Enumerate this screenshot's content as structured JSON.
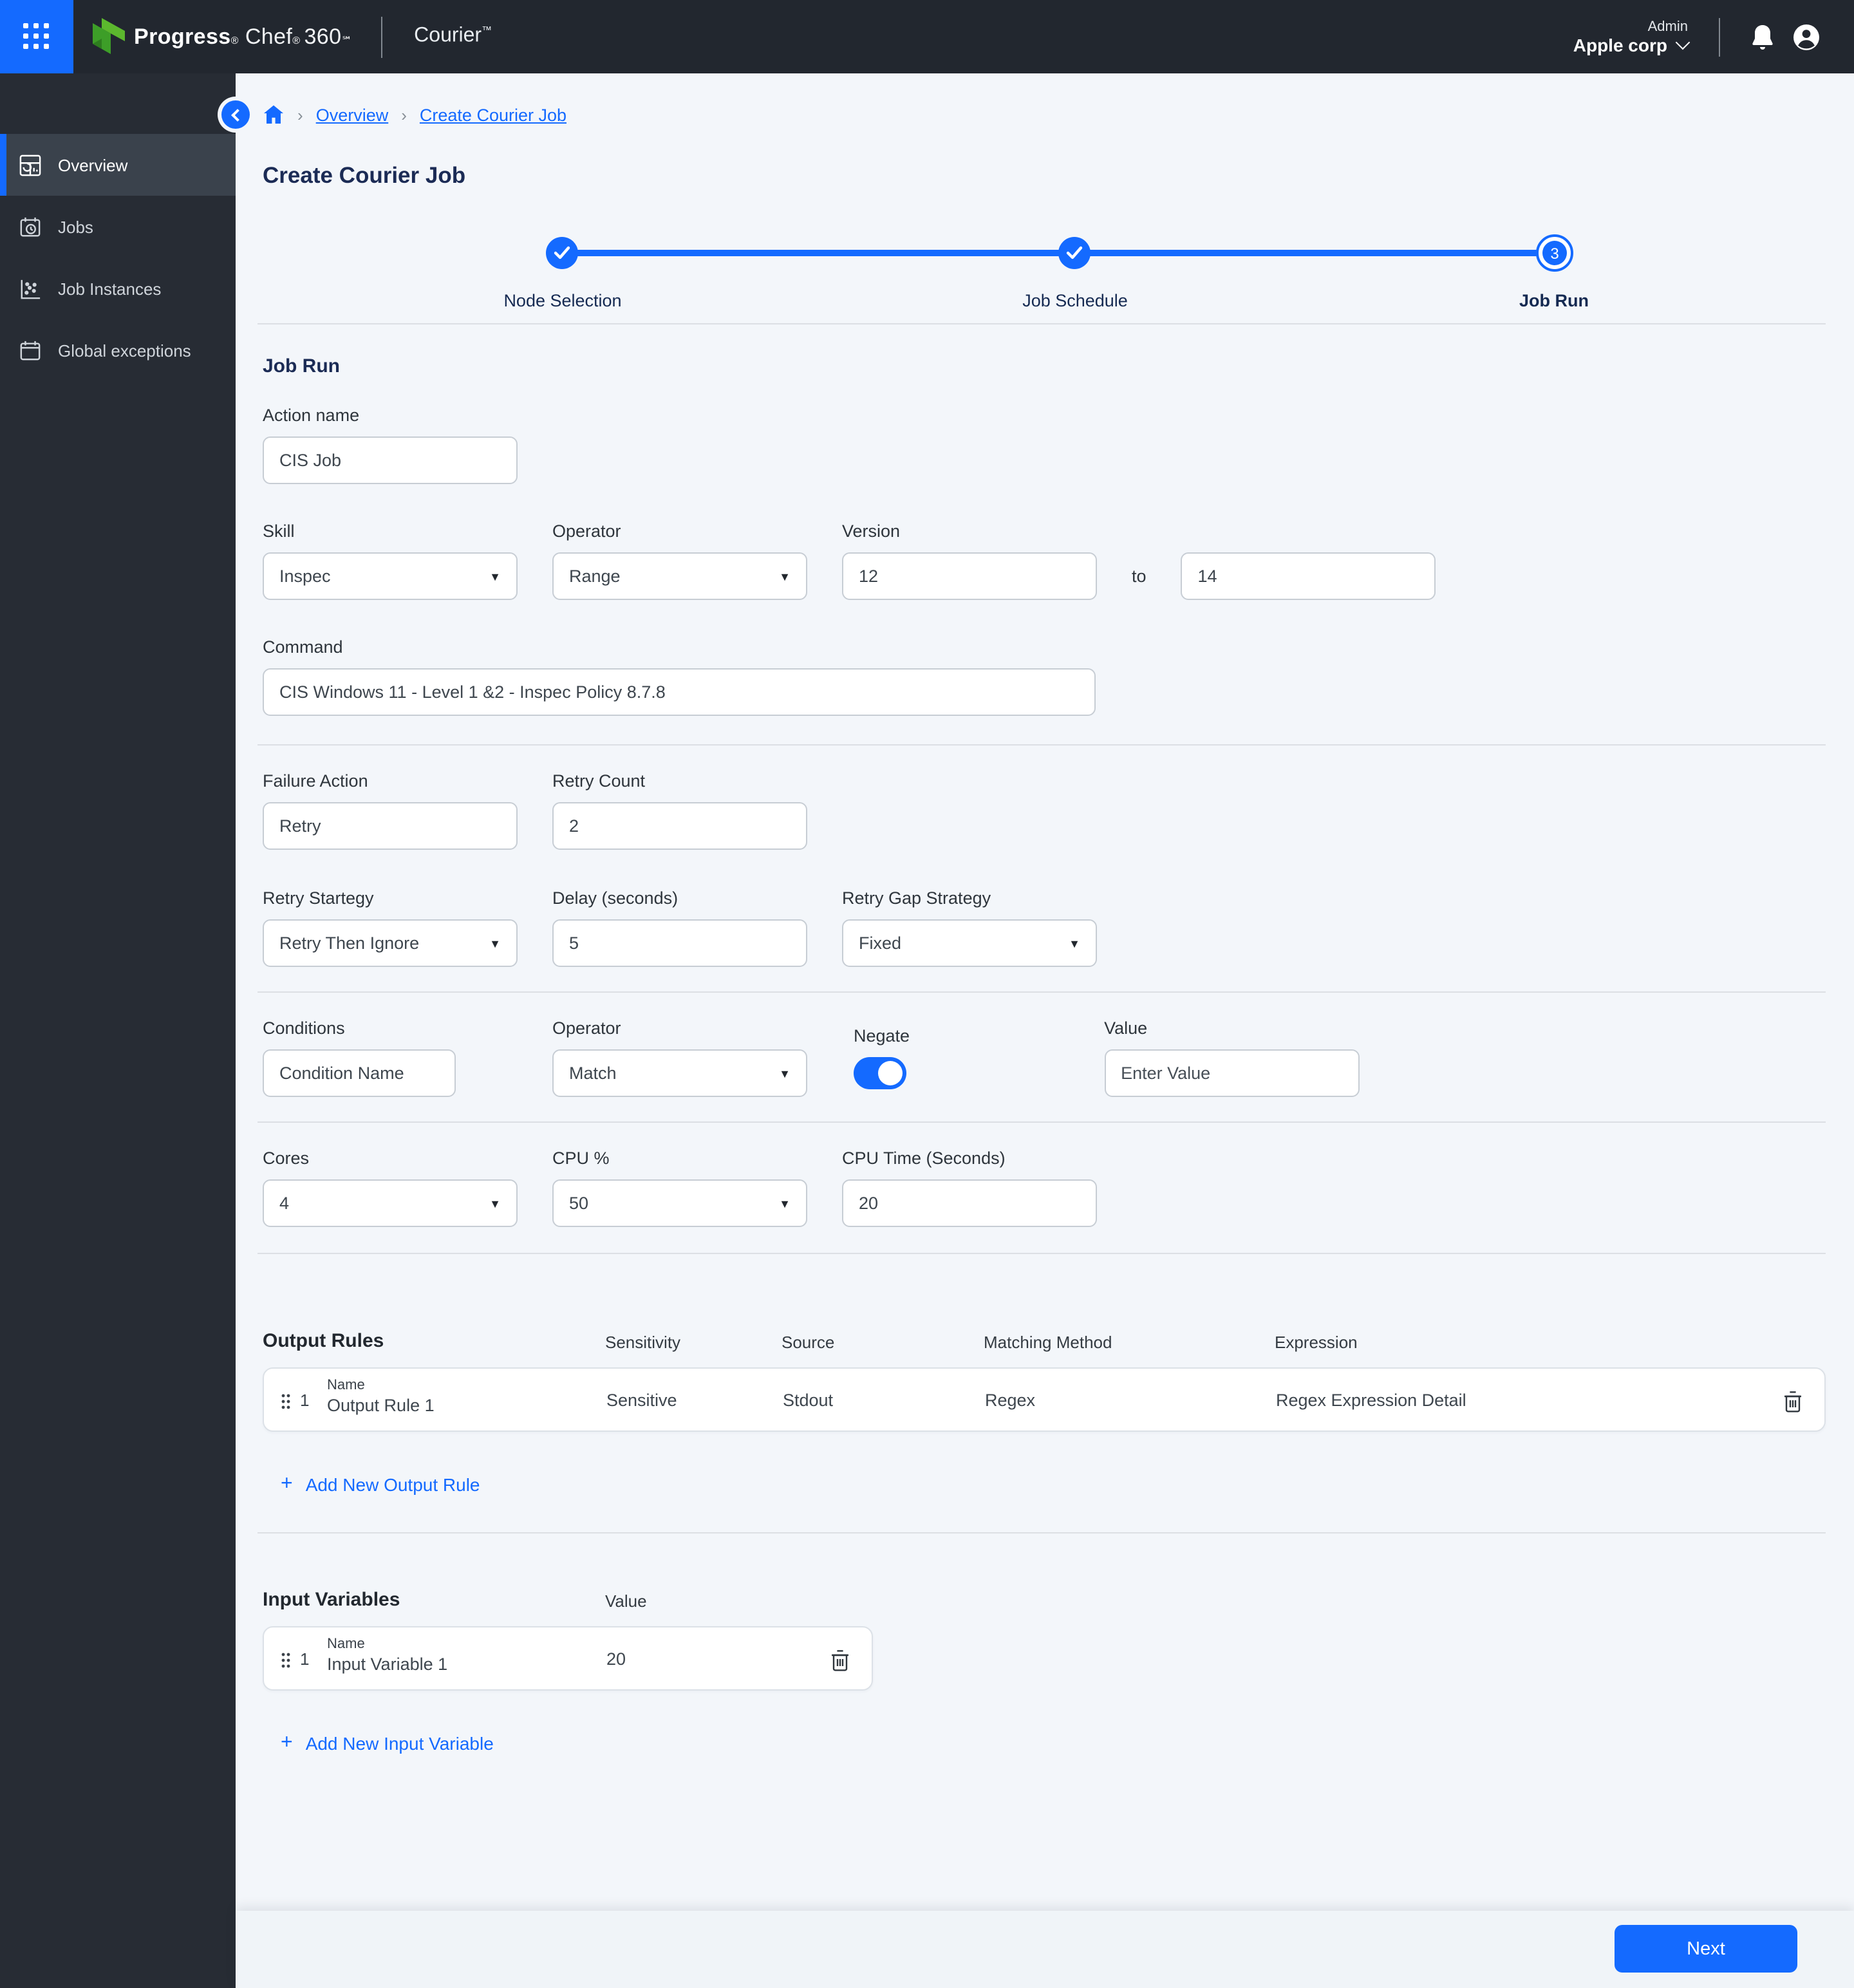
{
  "header": {
    "brand_bold": "Progress",
    "brand_reg": "®",
    "brand_chef": "Chef",
    "brand_chef_reg": "®",
    "brand_num": "360",
    "brand_sm": "℠",
    "product": "Courier",
    "product_tm": "™",
    "role": "Admin",
    "org": "Apple corp"
  },
  "sidebar": {
    "items": [
      {
        "label": "Overview"
      },
      {
        "label": "Jobs"
      },
      {
        "label": "Job Instances"
      },
      {
        "label": "Global exceptions"
      }
    ]
  },
  "breadcrumb": {
    "link1": "Overview",
    "link2": "Create Courier Job"
  },
  "page": {
    "title": "Create Courier Job"
  },
  "stepper": {
    "step1": {
      "label": "Node Selection"
    },
    "step2": {
      "label": "Job Schedule"
    },
    "step3": {
      "label": "Job Run",
      "number": "3"
    }
  },
  "form": {
    "section_title": "Job Run",
    "action_name": {
      "label": "Action name",
      "value": "CIS Job"
    },
    "skill": {
      "label": "Skill",
      "value": "Inspec"
    },
    "operator": {
      "label": "Operator",
      "value": "Range"
    },
    "version": {
      "label": "Version",
      "from": "12",
      "to_label": "to",
      "to": "14"
    },
    "command": {
      "label": "Command",
      "value": "CIS Windows 11 - Level 1 &2 - Inspec Policy 8.7.8"
    },
    "failure_action": {
      "label": "Failure Action",
      "value": "Retry"
    },
    "retry_count": {
      "label": "Retry Count",
      "value": "2"
    },
    "retry_strategy": {
      "label": "Retry Startegy",
      "value": "Retry Then Ignore"
    },
    "delay": {
      "label": "Delay (seconds)",
      "value": "5"
    },
    "retry_gap_strategy": {
      "label": "Retry Gap Strategy",
      "value": "Fixed"
    },
    "conditions": {
      "label": "Conditions",
      "value": "Condition Name"
    },
    "cond_operator": {
      "label": "Operator",
      "value": "Match"
    },
    "negate": {
      "label": "Negate"
    },
    "value_field": {
      "label": "Value",
      "placeholder": "Enter Value"
    },
    "cores": {
      "label": "Cores",
      "value": "4"
    },
    "cpu_pct": {
      "label": "CPU %",
      "value": "50"
    },
    "cpu_time": {
      "label": "CPU Time (Seconds)",
      "value": "20"
    }
  },
  "output_rules": {
    "title": "Output Rules",
    "headers": {
      "sensitivity": "Sensitivity",
      "source": "Source",
      "matching_method": "Matching Method",
      "expression": "Expression"
    },
    "rows": [
      {
        "index": "1",
        "name_label": "Name",
        "name": "Output Rule 1",
        "sensitivity": "Sensitive",
        "source": "Stdout",
        "matching_method": "Regex",
        "expression": "Regex Expression Detail"
      }
    ],
    "add_label": "Add New Output Rule"
  },
  "input_variables": {
    "title": "Input Variables",
    "value_header": "Value",
    "rows": [
      {
        "index": "1",
        "name_label": "Name",
        "name": "Input Variable 1",
        "value": "20"
      }
    ],
    "add_label": "Add New Input Variable"
  },
  "footer": {
    "next_label": "Next"
  },
  "colors": {
    "primary": "#146aff",
    "header_bg": "#22272f",
    "sidebar_bg": "#272c34",
    "navy": "#1b2b55",
    "content_bg": "#f3f6fa"
  }
}
